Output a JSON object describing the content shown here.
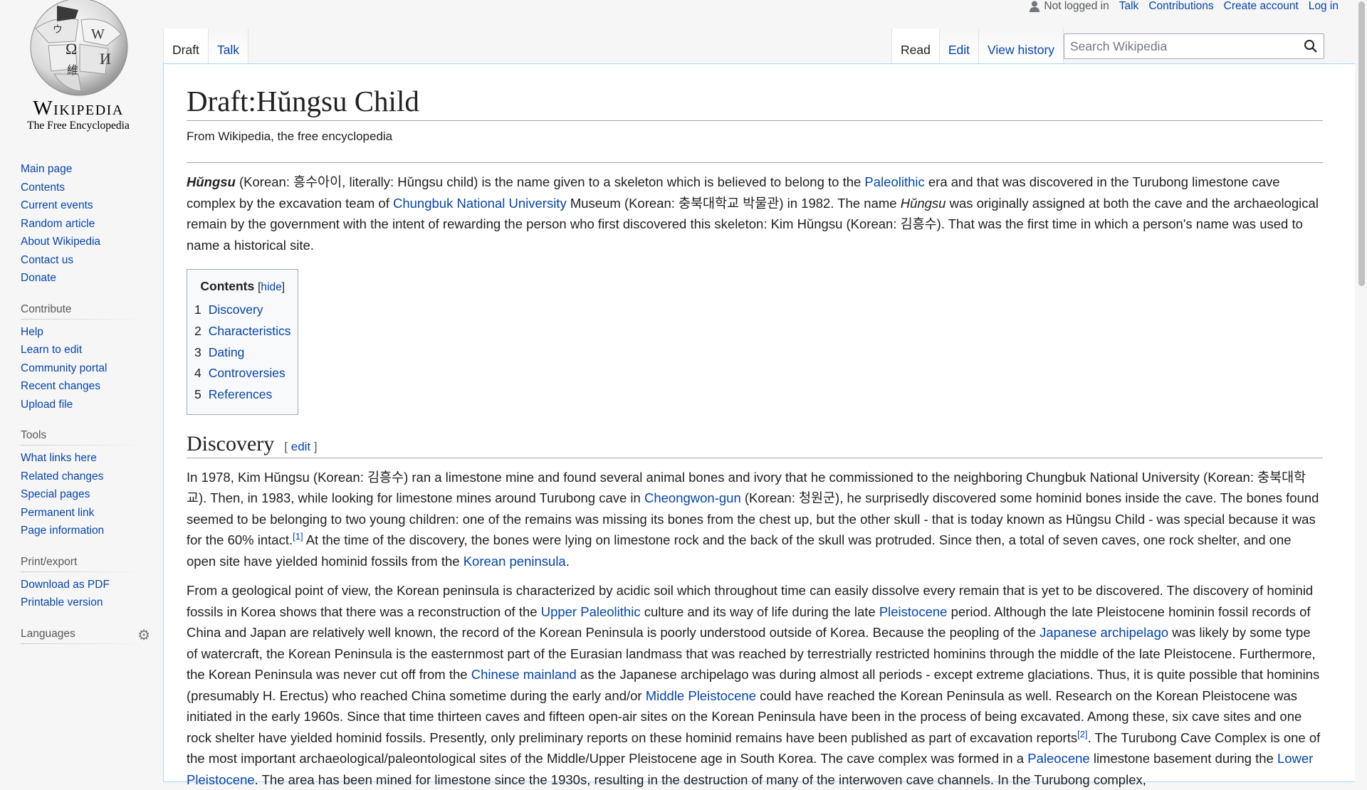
{
  "logo": {
    "wordmark": "Wikipedia",
    "tagline": "The Free Encyclopedia"
  },
  "personal": {
    "user_status": "Not logged in",
    "talk": "Talk",
    "contributions": "Contributions",
    "create_account": "Create account",
    "log_in": "Log in"
  },
  "tabs_left": [
    {
      "label": "Draft"
    },
    {
      "label": "Talk"
    }
  ],
  "tabs_right": [
    {
      "label": "Read"
    },
    {
      "label": "Edit"
    },
    {
      "label": "View history"
    }
  ],
  "search": {
    "placeholder": "Search Wikipedia"
  },
  "sidebar": {
    "navigation": [
      "Main page",
      "Contents",
      "Current events",
      "Random article",
      "About Wikipedia",
      "Contact us",
      "Donate"
    ],
    "contribute": {
      "heading": "Contribute",
      "items": [
        "Help",
        "Learn to edit",
        "Community portal",
        "Recent changes",
        "Upload file"
      ]
    },
    "tools": {
      "heading": "Tools",
      "items": [
        "What links here",
        "Related changes",
        "Special pages",
        "Permanent link",
        "Page information"
      ]
    },
    "print": {
      "heading": "Print/export",
      "items": [
        "Download as PDF",
        "Printable version"
      ]
    },
    "languages": {
      "heading": "Languages"
    }
  },
  "article": {
    "title": "Draft:Hŭngsu Child",
    "tagline": "From Wikipedia, the free encyclopedia",
    "intro": {
      "t0": "Hŭngsu",
      "t1": " (Korean: 흥수아이, literally: Hŭngsu child) is the name given to a skeleton which is believed to belong to the ",
      "l1": "Paleolithic",
      "t2": " era and that was discovered in the Turubong limestone cave complex by the excavation team of ",
      "l2": "Chungbuk National University",
      "t3": " Museum (Korean: 충북대학교 박물관) in 1982. The name ",
      "t4": "Hŭngsu",
      "t5": " was originally assigned at both the cave and the archaeological remain by the government with the intent of rewarding the person who first discovered this skeleton: Kim Hŭngsu (Korean: 김흥수). That was the first time in which a person's name was used to name a historical site."
    },
    "toc": {
      "title": "Contents",
      "hide": "hide",
      "items": [
        {
          "num": "1",
          "label": "Discovery"
        },
        {
          "num": "2",
          "label": "Characteristics"
        },
        {
          "num": "3",
          "label": "Dating"
        },
        {
          "num": "4",
          "label": "Controversies"
        },
        {
          "num": "5",
          "label": "References"
        }
      ]
    },
    "discovery": {
      "heading": "Discovery",
      "edit": "edit",
      "p1": {
        "t1": "In 1978, Kim Hŭngsu (Korean: 김흥수) ran a limestone mine and found several animal bones and ivory that he commissioned to the neighboring Chungbuk National University (Korean: 충북대학교). Then, in 1983, while looking for limestone mines around Turubong cave in ",
        "l1": "Cheongwon-gun",
        "t2": " (Korean: 청원군), he surprisedly discovered some hominid bones inside the cave. The bones found seemed to be belonging to two young children: one of the remains was missing its bones from the chest up, but the other skull - that is today known as Hŭngsu Child - was special because it was for the 60% intact.",
        "ref": "[1]",
        "t3": " At the time of the discovery, the bones were lying on limestone rock and the back of the skull was protruded. Since then, a total of seven caves, one rock shelter, and one open site have yielded hominid fossils from the ",
        "l2": "Korean peninsula",
        "t4": "."
      },
      "p2": {
        "t1": "From a geological point of view, the Korean peninsula is characterized by acidic soil which throughout time can easily dissolve every remain that is yet to be discovered. The discovery of hominid fossils in Korea shows that there was a reconstruction of the ",
        "l1": "Upper Paleolithic",
        "t2": " culture and its way of life during the late ",
        "l2": "Pleistocene",
        "t3": " period. Although the late Pleistocene hominin fossil records of China and Japan are relatively well known, the record of the Korean Peninsula is poorly understood outside of Korea. Because the peopling of the ",
        "l3": "Japanese archipelago",
        "t4": " was likely by some type of watercraft, the Korean Peninsula is the easternmost part of the Eurasian landmass that was reached by terrestrially restricted hominins through the middle of the late Pleistocene. Furthermore, the Korean Peninsula was never cut off from the ",
        "l4": "Chinese mainland",
        "t5": " as the Japanese archipelago was during almost all periods - except extreme glaciations. Thus, it is quite possible that hominins (presumably H. Erectus) who reached China sometime during the early and/or ",
        "l5": "Middle Pleistocene",
        "t6": " could have reached the Korean Peninsula as well. Research on the Korean Pleistocene was initiated in the early 1960s. Since that time thirteen caves and fifteen open-air sites on the Korean Peninsula have been in the process of being excavated. Among these, six cave sites and one rock shelter have yielded hominid fossils. Presently, only preliminary reports on these hominid remains have been published as part of excavation reports",
        "ref": "[2]",
        "t7": ". The Turubong Cave Complex is one of the most important archaeological/paleontological sites of the Middle/Upper Pleistocene age in South Korea. The cave complex was formed in a ",
        "l6": "Paleocene",
        "t8": " limestone basement during the ",
        "l7": "Lower Pleistocene",
        "t9": ". The area has been mined for limestone since the 1930s, resulting in the destruction of many of the interwoven cave channels. In the Turubong complex,"
      }
    }
  }
}
